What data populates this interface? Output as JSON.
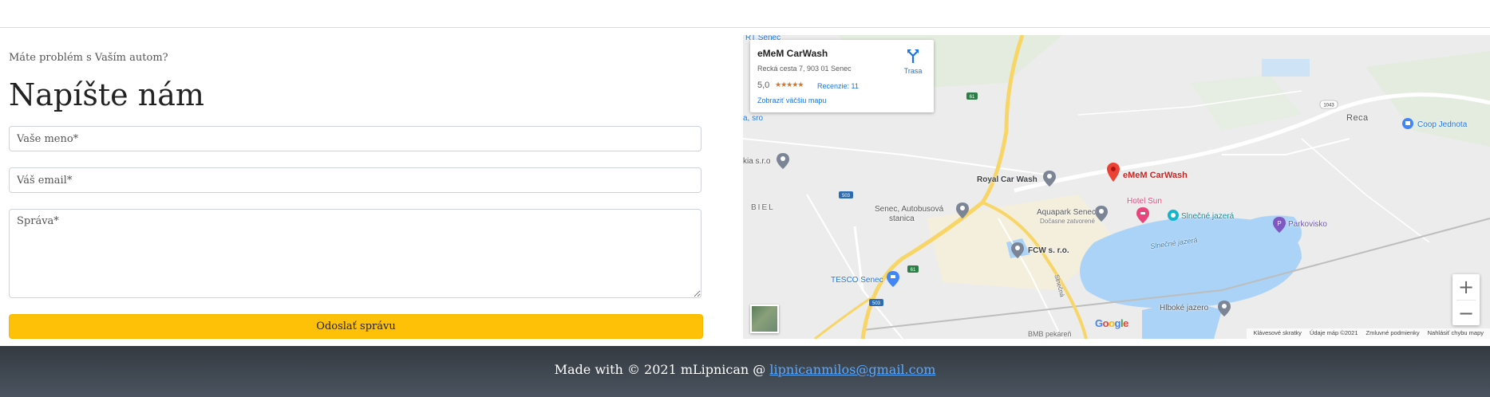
{
  "contact": {
    "kicker": "Máte problém s Vaším autom?",
    "heading": "Napíšte nám",
    "name_placeholder": "Vaše meno*",
    "email_placeholder": "Váš email*",
    "message_placeholder": "Správa*",
    "submit_label": "Odoslať správu"
  },
  "map": {
    "card": {
      "title": "eMeM CarWash",
      "address": "Recká cesta 7, 903 01 Senec",
      "rating": "5,0",
      "stars": "★★★★★",
      "reviews": "Recenzie: 11",
      "directions": "Trasa",
      "bigger_map": "Zobraziť väčšiu mapu"
    },
    "places": {
      "emem": "eMeM CarWash",
      "royal": "Royal Car Wash",
      "coop": "Coop Jednota",
      "reca": "Reca",
      "senec_station_1": "Senec, Autobusová",
      "senec_station_2": "stanica",
      "aquapark_1": "Aquapark Senec",
      "aquapark_2": "Dočasne zatvorené",
      "hotel": "Hotel Sun",
      "slnecne_pin": "Slnečné jazerá",
      "slnecne_lake": "Slnečné jazerá",
      "parkovisko": "Parkovisko",
      "fcw": "FCW s. r.o.",
      "tesco": "TESCO Senec",
      "hlboke": "Hlboké jazero",
      "biel": "BIEL",
      "kia": "kia s.r.o",
      "sro": "a, sro",
      "rt_senec": "RT Senec",
      "bmb": "BMB pekáreň",
      "slnecna": "Slnečná"
    },
    "roads": [
      "61",
      "503",
      "1043",
      "61",
      "503"
    ],
    "google": "Google",
    "attribution": {
      "shortcuts": "Klávesové skratky",
      "data": "Údaje máp ©2021",
      "terms": "Zmluvné podmienky",
      "report": "Nahlásiť chybu mapy"
    },
    "zoom_in": "+",
    "zoom_out": "−"
  },
  "footer": {
    "text": "Made with © 2021 mLipnican @",
    "email": "lipnicanmilos@gmail.com"
  },
  "colors": {
    "button": "#ffc107",
    "footer": "#343a40",
    "link": "#1a73e8",
    "pin": "#ea4335"
  }
}
